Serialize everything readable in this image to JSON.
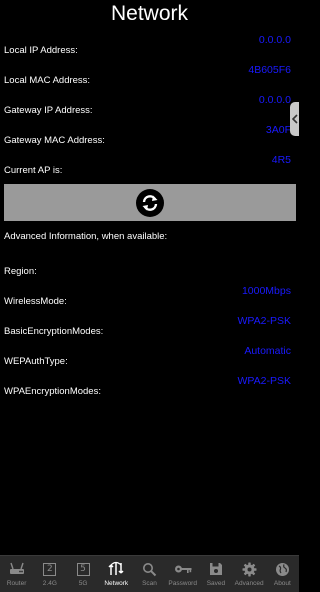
{
  "header": {
    "title": "Network"
  },
  "rows": [
    {
      "label": "Local IP Address:",
      "value": "0.0.0.0"
    },
    {
      "label": "Local MAC Address:",
      "value": "4B605F6"
    },
    {
      "label": "Gateway IP Address:",
      "value": "0.0.0.0"
    },
    {
      "label": "Gateway MAC Address:",
      "value": "3A0F"
    },
    {
      "label": "Current AP is:",
      "value": "4R5"
    }
  ],
  "advanced": {
    "heading": "Advanced Information, when available:",
    "rows": [
      {
        "label": "Region:",
        "value": ""
      },
      {
        "label": "WirelessMode:",
        "value": "1000Mbps"
      },
      {
        "label": "BasicEncryptionModes:",
        "value": "WPA2-PSK"
      },
      {
        "label": "WEPAuthType:",
        "value": "Automatic"
      },
      {
        "label": "WPAEncryptionModes:",
        "value": "WPA2-PSK"
      }
    ]
  },
  "nav": [
    {
      "label": "Router",
      "icon": "router-icon"
    },
    {
      "label": "2.4G",
      "icon": "box-2-icon",
      "box": "2"
    },
    {
      "label": "5G",
      "icon": "box-5-icon",
      "box": "5"
    },
    {
      "label": "Network",
      "icon": "network-icon",
      "active": true
    },
    {
      "label": "Scan",
      "icon": "search-icon"
    },
    {
      "label": "Password",
      "icon": "key-icon"
    },
    {
      "label": "Saved",
      "icon": "save-icon"
    },
    {
      "label": "Advanced",
      "icon": "gear-icon"
    },
    {
      "label": "About",
      "icon": "globe-icon"
    }
  ],
  "colors": {
    "value": "#1a1aff",
    "background": "#000000",
    "button": "#9a9a9a",
    "navbar": "#2a2a2a"
  }
}
